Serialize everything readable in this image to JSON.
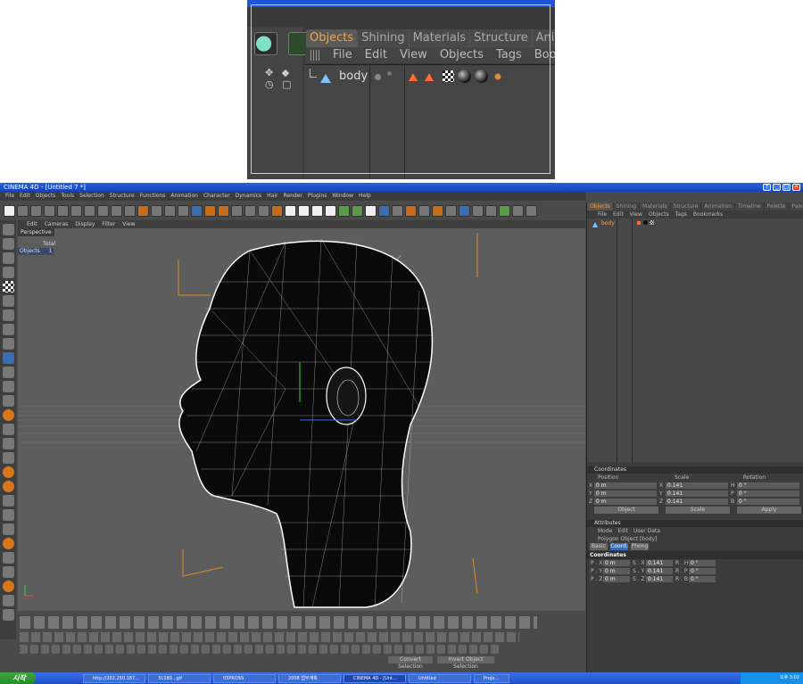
{
  "zoom": {
    "tabs": [
      "Objects",
      "Shining",
      "Materials",
      "Structure",
      "Anima"
    ],
    "menu": [
      "File",
      "Edit",
      "View",
      "Objects",
      "Tags",
      "Bookm"
    ],
    "object_name": "body"
  },
  "window": {
    "title": "CINEMA 4D - [Untitled 7 *]",
    "menu": [
      "File",
      "Edit",
      "Objects",
      "Tools",
      "Selection",
      "Structure",
      "Functions",
      "Animation",
      "Character",
      "Dynamics",
      "Hair",
      "Render",
      "Plugins",
      "Window",
      "Help"
    ],
    "view_menu": [
      "Edit",
      "Cameras",
      "Display",
      "Filter",
      "View"
    ],
    "viewport": {
      "label": "Perspective",
      "stats_header": "Total",
      "stats_label": "Objects",
      "stats_value": "1"
    },
    "bottom_buttons": {
      "convert": "Convert Selection",
      "invert": "Invert Object Selection"
    }
  },
  "right_panel": {
    "tabs": [
      "Objects",
      "Shining",
      "Materials",
      "Structure",
      "Animation",
      "Timeline",
      "Palette",
      "Palette"
    ],
    "menu": [
      "File",
      "Edit",
      "View",
      "Objects",
      "Tags",
      "Bookmarks"
    ],
    "object_name": "body",
    "coordinates": {
      "title": "Coordinates",
      "col_position": "Position",
      "col_scale": "Scale",
      "col_rotation": "Rotation",
      "rows": [
        {
          "axis": "X",
          "pos": "0 m",
          "sc_axis": "X",
          "scale": "0.141",
          "rot_axis": "H",
          "rot": "0 °"
        },
        {
          "axis": "Y",
          "pos": "0 m",
          "sc_axis": "Y",
          "scale": "0.141",
          "rot_axis": "P",
          "rot": "0 °"
        },
        {
          "axis": "Z",
          "pos": "0 m",
          "sc_axis": "Z",
          "scale": "0.141",
          "rot_axis": "B",
          "rot": "0 °"
        }
      ],
      "mode_select": "Object",
      "scale_select": "Scale",
      "apply": "Apply"
    },
    "attributes": {
      "title": "Attributes",
      "menu": [
        "Mode",
        "Edit",
        "User Data"
      ],
      "object_label": "Polygon Object [body]",
      "tabs": [
        "Basic",
        "Coord.",
        "Phong"
      ],
      "section": "Coordinates",
      "rows": [
        {
          "p": "P . X",
          "pv": "0 m",
          "s": "S . X",
          "sv": "0.141",
          "r": "R . H",
          "rv": "0 °"
        },
        {
          "p": "P . Y",
          "pv": "0 m",
          "s": "S . Y",
          "sv": "0.141",
          "r": "R . P",
          "rv": "0 °"
        },
        {
          "p": "P . Z",
          "pv": "0 m",
          "s": "S . Z",
          "sv": "0.141",
          "r": "R . B",
          "rv": "0 °"
        }
      ]
    }
  },
  "taskbar": {
    "start": "시작",
    "tasks": [
      "http://202.250.187...",
      "31180...gif",
      "03PROSS",
      "2008 업무계획",
      "CINEMA 4D - [Unt...",
      "Untitled",
      "Proje..."
    ],
    "clock": "오후 3:02"
  }
}
